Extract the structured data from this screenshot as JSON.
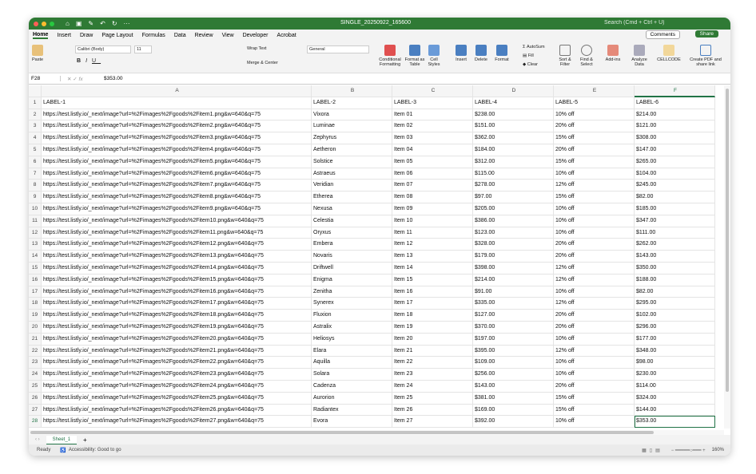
{
  "window": {
    "filename": "SINGLE_20250922_165600",
    "search_placeholder": "Search (Cmd + Ctrl + U)"
  },
  "menu": {
    "tabs": [
      "Home",
      "Insert",
      "Draw",
      "Page Layout",
      "Formulas",
      "Data",
      "Review",
      "View",
      "Developer",
      "Acrobat"
    ],
    "comments": "Comments",
    "share": "Share"
  },
  "ribbon": {
    "paste": "Paste",
    "font": "Calibri (Body)",
    "size": "11",
    "wrap": "Wrap Text",
    "merge": "Merge & Center",
    "number_format": "General",
    "conditional": "Conditional Formatting",
    "format_table": "Format as Table",
    "cell_styles": "Cell Styles",
    "insert": "Insert",
    "delete": "Delete",
    "format": "Format",
    "autosum": "AutoSum",
    "fill": "Fill",
    "clear": "Clear",
    "sort": "Sort & Filter",
    "find": "Find & Select",
    "addins": "Add-ins",
    "analyze": "Analyze Data",
    "cellcode": "CELLCODE",
    "pdf": "Create PDF and share link"
  },
  "formula": {
    "cell_ref": "F28",
    "value": "$353.00"
  },
  "columns": [
    "A",
    "B",
    "C",
    "D",
    "E",
    "F"
  ],
  "rows": [
    [
      "LABEL-1",
      "LABEL-2",
      "LABEL-3",
      "LABEL-4",
      "LABEL-5",
      "LABEL-6"
    ],
    [
      "https://test.listly.io/_next/image?url=%2Fimages%2Fgoods%2Fitem1.png&w=640&q=75",
      "Vixora",
      "Item 01",
      "$238.00",
      "10% off",
      "$214.00"
    ],
    [
      "https://test.listly.io/_next/image?url=%2Fimages%2Fgoods%2Fitem2.png&w=640&q=75",
      "Luminae",
      "Item 02",
      "$151.00",
      "20% off",
      "$121.00"
    ],
    [
      "https://test.listly.io/_next/image?url=%2Fimages%2Fgoods%2Fitem3.png&w=640&q=75",
      "Zephyrus",
      "Item 03",
      "$362.00",
      "15% off",
      "$308.00"
    ],
    [
      "https://test.listly.io/_next/image?url=%2Fimages%2Fgoods%2Fitem4.png&w=640&q=75",
      "Aetheron",
      "Item 04",
      "$184.00",
      "20% off",
      "$147.00"
    ],
    [
      "https://test.listly.io/_next/image?url=%2Fimages%2Fgoods%2Fitem5.png&w=640&q=75",
      "Solstice",
      "Item 05",
      "$312.00",
      "15% off",
      "$265.00"
    ],
    [
      "https://test.listly.io/_next/image?url=%2Fimages%2Fgoods%2Fitem6.png&w=640&q=75",
      "Astraeus",
      "Item 06",
      "$115.00",
      "10% off",
      "$104.00"
    ],
    [
      "https://test.listly.io/_next/image?url=%2Fimages%2Fgoods%2Fitem7.png&w=640&q=75",
      "Veridian",
      "Item 07",
      "$278.00",
      "12% off",
      "$245.00"
    ],
    [
      "https://test.listly.io/_next/image?url=%2Fimages%2Fgoods%2Fitem8.png&w=640&q=75",
      "Etherea",
      "Item 08",
      "$97.00",
      "15% off",
      "$82.00"
    ],
    [
      "https://test.listly.io/_next/image?url=%2Fimages%2Fgoods%2Fitem9.png&w=640&q=75",
      "Nexusa",
      "Item 09",
      "$205.00",
      "10% off",
      "$185.00"
    ],
    [
      "https://test.listly.io/_next/image?url=%2Fimages%2Fgoods%2Fitem10.png&w=640&q=75",
      "Celestia",
      "Item 10",
      "$386.00",
      "10% off",
      "$347.00"
    ],
    [
      "https://test.listly.io/_next/image?url=%2Fimages%2Fgoods%2Fitem11.png&w=640&q=75",
      "Oryxus",
      "Item 11",
      "$123.00",
      "10% off",
      "$111.00"
    ],
    [
      "https://test.listly.io/_next/image?url=%2Fimages%2Fgoods%2Fitem12.png&w=640&q=75",
      "Embera",
      "Item 12",
      "$328.00",
      "20% off",
      "$262.00"
    ],
    [
      "https://test.listly.io/_next/image?url=%2Fimages%2Fgoods%2Fitem13.png&w=640&q=75",
      "Novaris",
      "Item 13",
      "$179.00",
      "20% off",
      "$143.00"
    ],
    [
      "https://test.listly.io/_next/image?url=%2Fimages%2Fgoods%2Fitem14.png&w=640&q=75",
      "Driftwell",
      "Item 14",
      "$398.00",
      "12% off",
      "$350.00"
    ],
    [
      "https://test.listly.io/_next/image?url=%2Fimages%2Fgoods%2Fitem15.png&w=640&q=75",
      "Enigma",
      "Item 15",
      "$214.00",
      "12% off",
      "$188.00"
    ],
    [
      "https://test.listly.io/_next/image?url=%2Fimages%2Fgoods%2Fitem16.png&w=640&q=75",
      "Zenitha",
      "Item 16",
      "$91.00",
      "10% off",
      "$82.00"
    ],
    [
      "https://test.listly.io/_next/image?url=%2Fimages%2Fgoods%2Fitem17.png&w=640&q=75",
      "Synerex",
      "Item 17",
      "$335.00",
      "12% off",
      "$295.00"
    ],
    [
      "https://test.listly.io/_next/image?url=%2Fimages%2Fgoods%2Fitem18.png&w=640&q=75",
      "Fluxion",
      "Item 18",
      "$127.00",
      "20% off",
      "$102.00"
    ],
    [
      "https://test.listly.io/_next/image?url=%2Fimages%2Fgoods%2Fitem19.png&w=640&q=75",
      "Astralix",
      "Item 19",
      "$370.00",
      "20% off",
      "$296.00"
    ],
    [
      "https://test.listly.io/_next/image?url=%2Fimages%2Fgoods%2Fitem20.png&w=640&q=75",
      "Heliosys",
      "Item 20",
      "$197.00",
      "10% off",
      "$177.00"
    ],
    [
      "https://test.listly.io/_next/image?url=%2Fimages%2Fgoods%2Fitem21.png&w=640&q=75",
      "Elara",
      "Item 21",
      "$395.00",
      "12% off",
      "$348.00"
    ],
    [
      "https://test.listly.io/_next/image?url=%2Fimages%2Fgoods%2Fitem22.png&w=640&q=75",
      "Aquilla",
      "Item 22",
      "$109.00",
      "10% off",
      "$98.00"
    ],
    [
      "https://test.listly.io/_next/image?url=%2Fimages%2Fgoods%2Fitem23.png&w=640&q=75",
      "Solara",
      "Item 23",
      "$256.00",
      "10% off",
      "$230.00"
    ],
    [
      "https://test.listly.io/_next/image?url=%2Fimages%2Fgoods%2Fitem24.png&w=640&q=75",
      "Cadenza",
      "Item 24",
      "$143.00",
      "20% off",
      "$114.00"
    ],
    [
      "https://test.listly.io/_next/image?url=%2Fimages%2Fgoods%2Fitem25.png&w=640&q=75",
      "Aurorion",
      "Item 25",
      "$381.00",
      "15% off",
      "$324.00"
    ],
    [
      "https://test.listly.io/_next/image?url=%2Fimages%2Fgoods%2Fitem26.png&w=640&q=75",
      "Radiantex",
      "Item 26",
      "$169.00",
      "15% off",
      "$144.00"
    ],
    [
      "https://test.listly.io/_next/image?url=%2Fimages%2Fgoods%2Fitem27.png&w=640&q=75",
      "Evora",
      "Item 27",
      "$392.00",
      "10% off",
      "$353.00"
    ]
  ],
  "selected": {
    "row": 28,
    "col": "F"
  },
  "sheets": [
    "Sheet_1"
  ],
  "status": {
    "ready": "Ready",
    "accessibility": "Accessibility: Good to go",
    "zoom": "160%"
  },
  "colors": {
    "brand": "#2f7a35",
    "selection": "#217346"
  }
}
